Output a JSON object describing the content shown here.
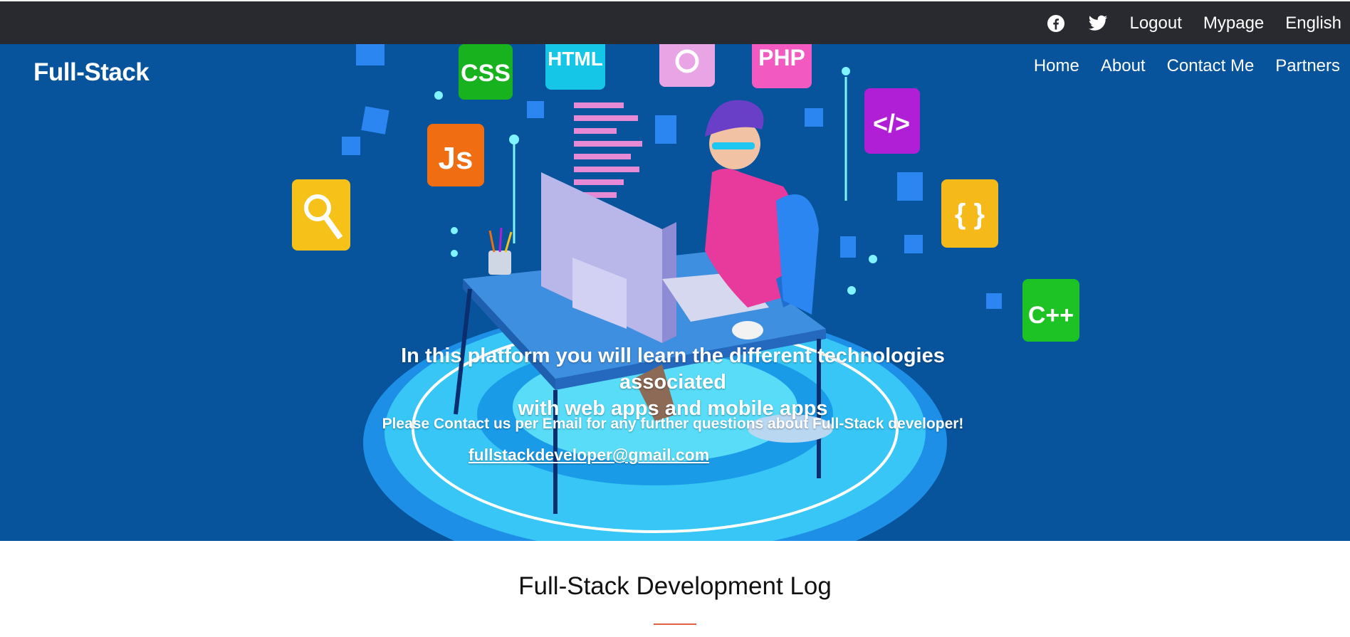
{
  "topbar": {
    "icons": [
      "facebook-icon",
      "twitter-icon"
    ],
    "links": [
      "Logout",
      "Mypage",
      "English"
    ]
  },
  "brand": "Full-Stack",
  "nav": [
    "Home",
    "About",
    "Contact Me",
    "Partners"
  ],
  "hero": {
    "headline_line1": "In this platform you will learn the different technologies associated",
    "headline_line2": "with web apps and mobile apps",
    "subtext": "Please Contact us per Email for any further questions about Full-Stack developer!",
    "email": "fullstackdeveloper@gmail.com",
    "tiles": [
      "CSS",
      "HTML",
      "PHP",
      "Js",
      "</>",
      "{ }",
      "C++"
    ]
  },
  "section": {
    "title": "Full-Stack Development Log"
  },
  "colors": {
    "topbar": "#282a30",
    "hero_bg": "#07539c",
    "accent": "#e0603f"
  }
}
